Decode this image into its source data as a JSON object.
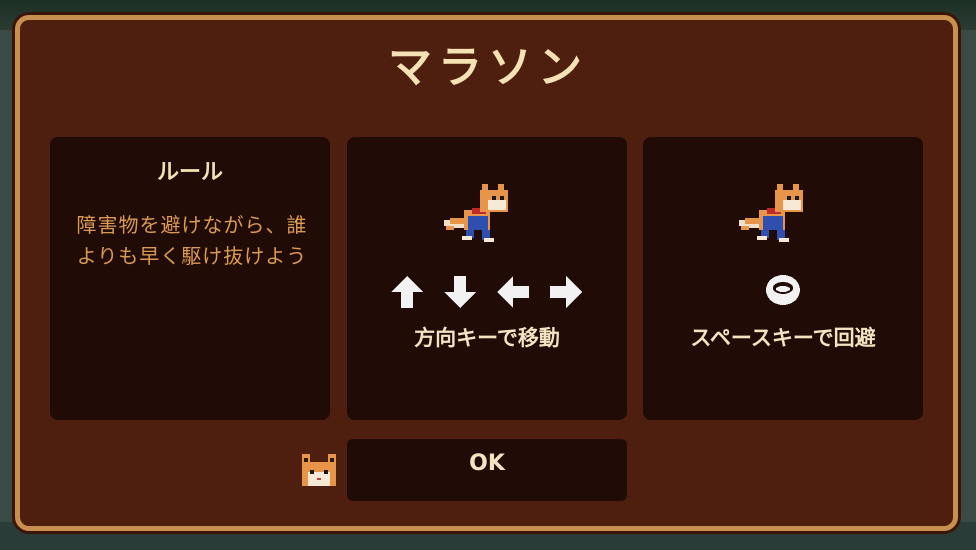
{
  "dialog": {
    "title": "マラソン"
  },
  "rules_panel": {
    "heading": "ルール",
    "description": "障害物を避けながら、誰よりも早く駆け抜けよう"
  },
  "move_panel": {
    "caption": "方向キーで移動",
    "keys": [
      "arrow-up-icon",
      "arrow-down-icon",
      "arrow-left-icon",
      "arrow-right-icon"
    ]
  },
  "dodge_panel": {
    "caption": "スペースキーで回避",
    "key": "space-key-icon"
  },
  "confirm": {
    "ok_label": "OK"
  },
  "colors": {
    "frame_border": "#c98f50",
    "dialog_bg": "#4e1e0e",
    "panel_bg": "#210b06",
    "title_text": "#f4e2b4",
    "rules_text": "#d99a52"
  }
}
